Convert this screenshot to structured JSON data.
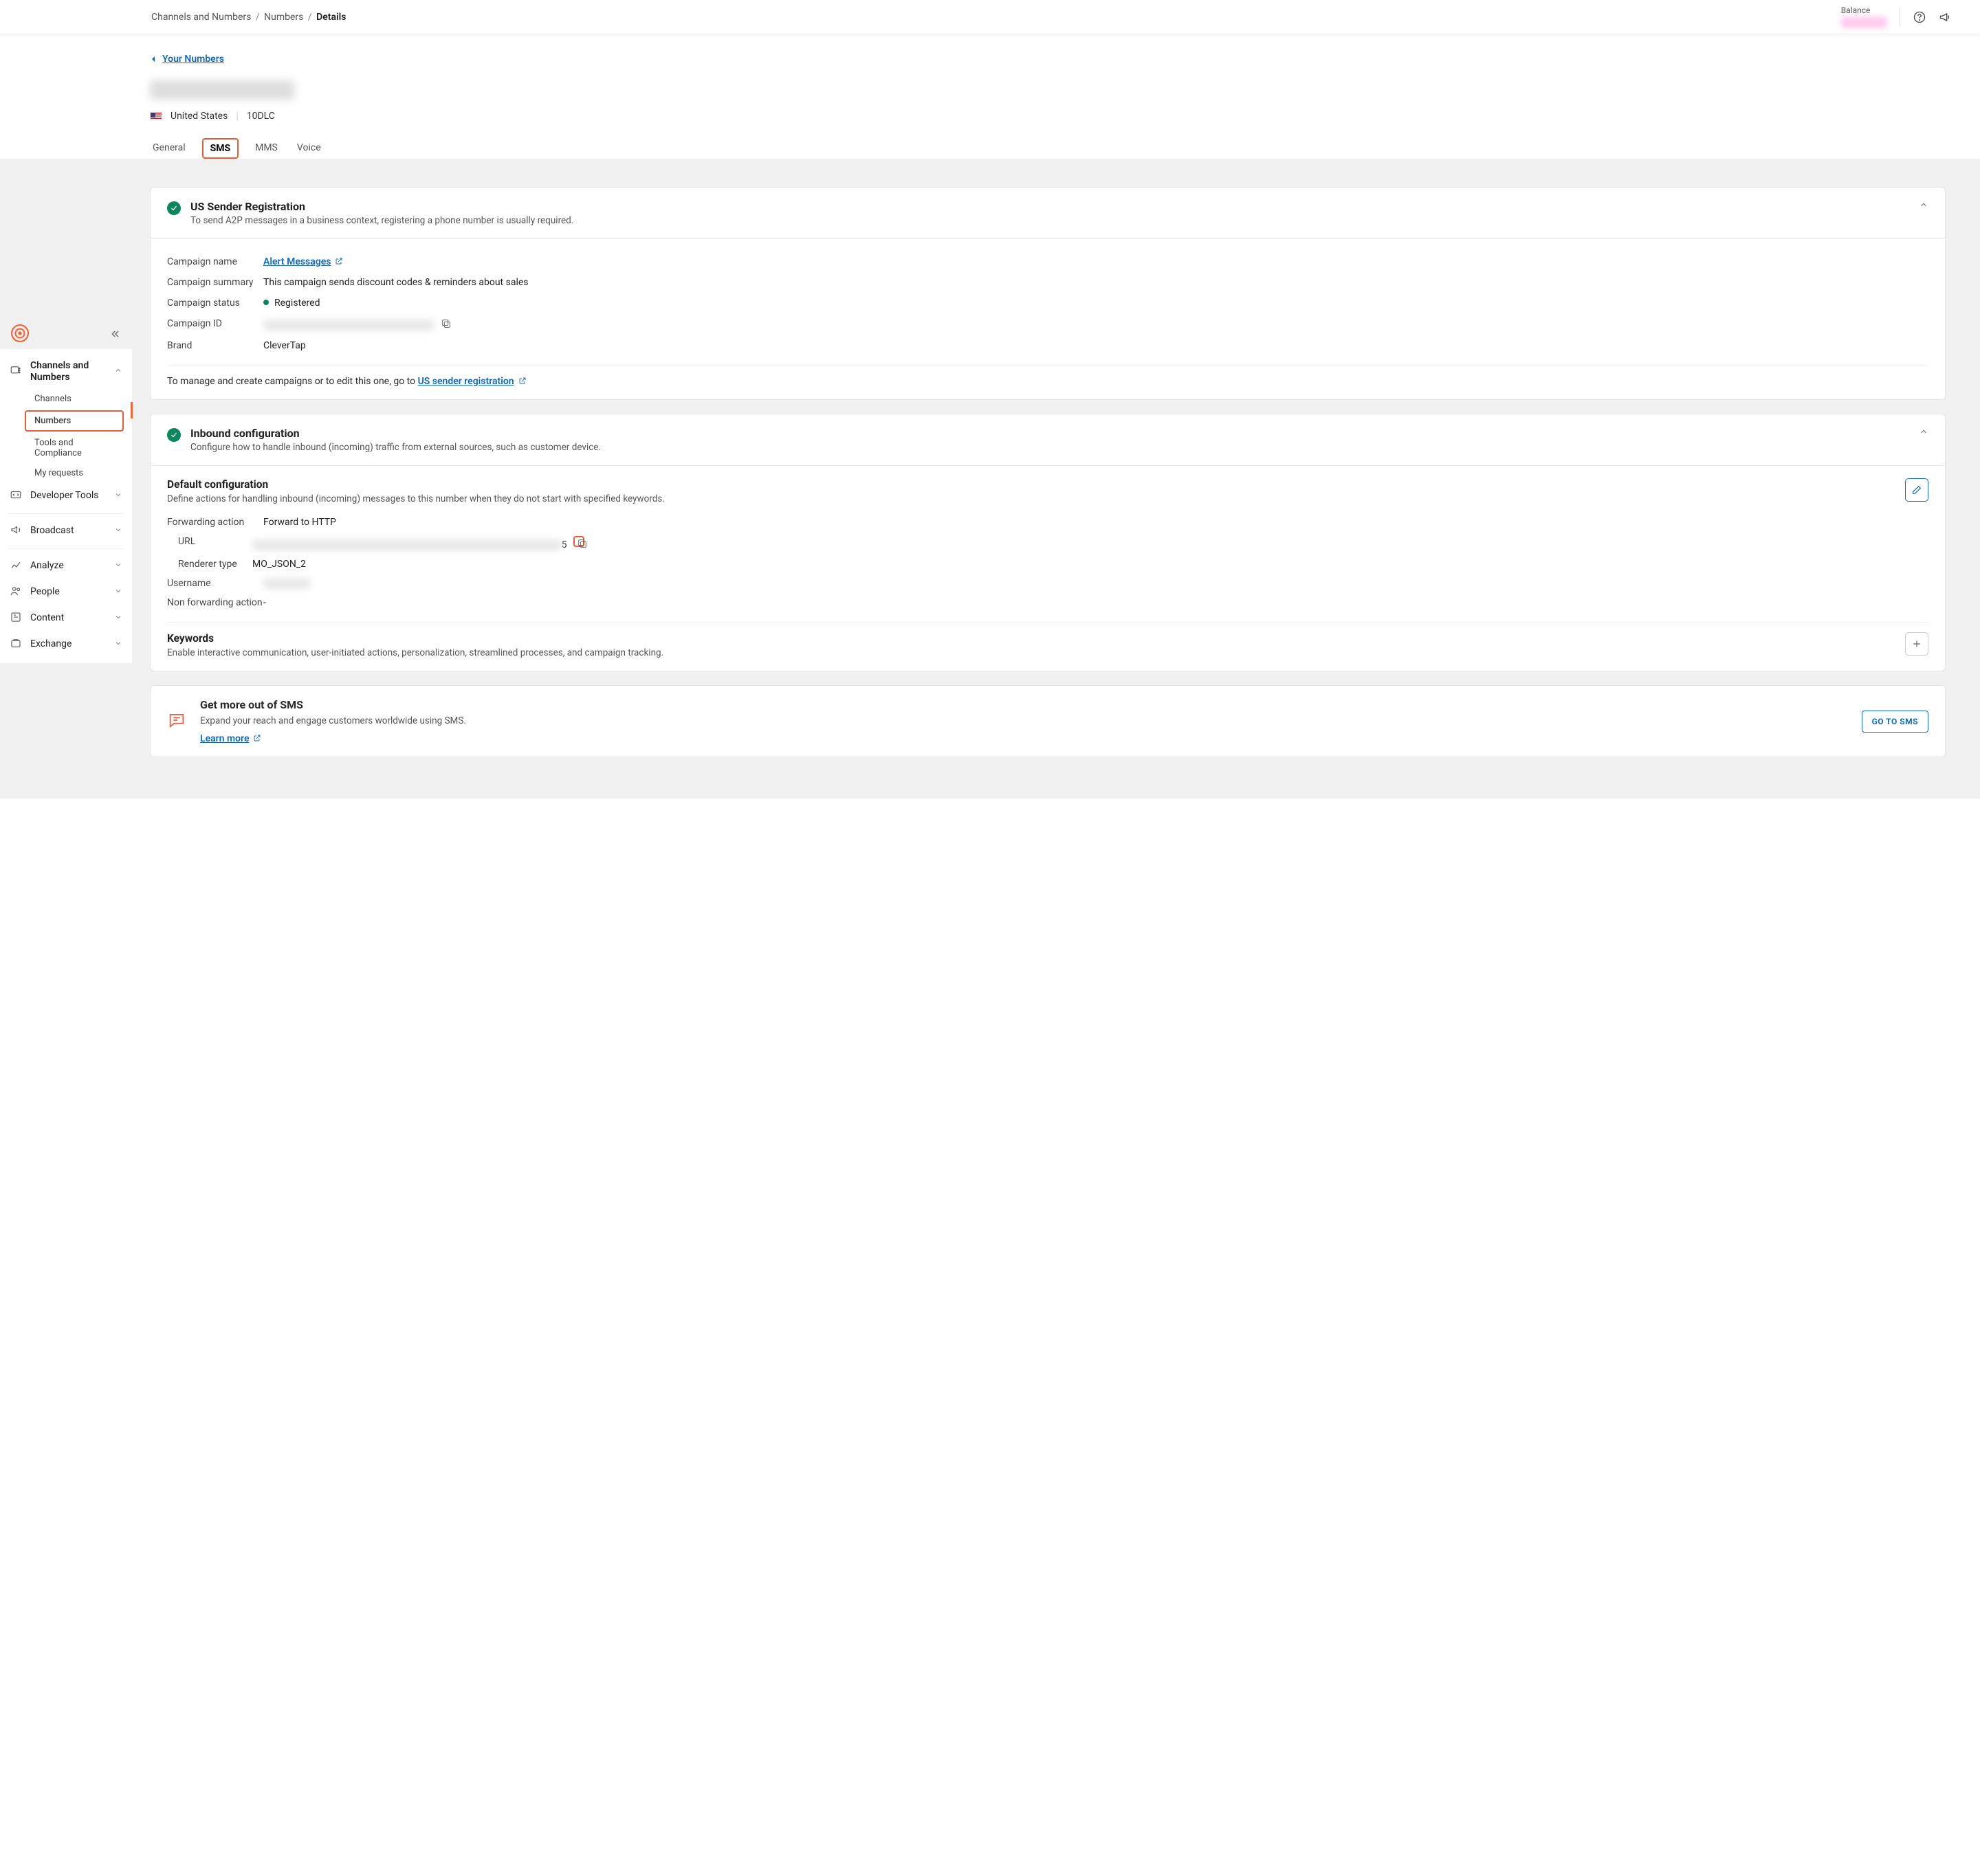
{
  "breadcrumb": {
    "a": "Channels and Numbers",
    "b": "Numbers",
    "c": "Details"
  },
  "balance_label": "Balance",
  "back_link": "Your Numbers",
  "country": "United States",
  "number_type": "10DLC",
  "tabs": {
    "general": "General",
    "sms": "SMS",
    "mms": "MMS",
    "voice": "Voice"
  },
  "registration": {
    "title": "US Sender Registration",
    "subtitle": "To send A2P messages in a business context, registering a phone number is usually required.",
    "campaign_name_label": "Campaign name",
    "campaign_name_value": "Alert Messages",
    "campaign_summary_label": "Campaign summary",
    "campaign_summary_value": "This campaign sends discount codes & reminders about sales",
    "campaign_status_label": "Campaign status",
    "campaign_status_value": "Registered",
    "campaign_id_label": "Campaign ID",
    "brand_label": "Brand",
    "brand_value": "CleverTap",
    "manage_text": "To manage and create campaigns or to edit this one, go to ",
    "manage_link": "US sender registration"
  },
  "inbound": {
    "title": "Inbound configuration",
    "subtitle": "Configure how to handle inbound (incoming) traffic from external sources, such as customer device.",
    "default_title": "Default configuration",
    "default_sub": "Define actions for handling inbound (incoming) messages to this number when they do not start with specified keywords.",
    "forwarding_label": "Forwarding action",
    "forwarding_value": "Forward to HTTP",
    "url_label": "URL",
    "url_suffix": "5",
    "renderer_label": "Renderer type",
    "renderer_value": "MO_JSON_2",
    "username_label": "Username",
    "nonfwd_label": "Non forwarding action",
    "nonfwd_value": "-",
    "keywords_title": "Keywords",
    "keywords_sub": "Enable interactive communication, user-initiated actions, personalization, streamlined processes, and campaign tracking."
  },
  "promo": {
    "title": "Get more out of SMS",
    "sub": "Expand your reach and engage customers worldwide using SMS.",
    "learn": "Learn more",
    "cta": "GO TO SMS"
  },
  "sidebar": {
    "channels_numbers": "Channels and Numbers",
    "channels": "Channels",
    "numbers": "Numbers",
    "tools": "Tools and Compliance",
    "requests": "My requests",
    "developer": "Developer Tools",
    "broadcast": "Broadcast",
    "analyze": "Analyze",
    "people": "People",
    "content": "Content",
    "exchange": "Exchange"
  }
}
